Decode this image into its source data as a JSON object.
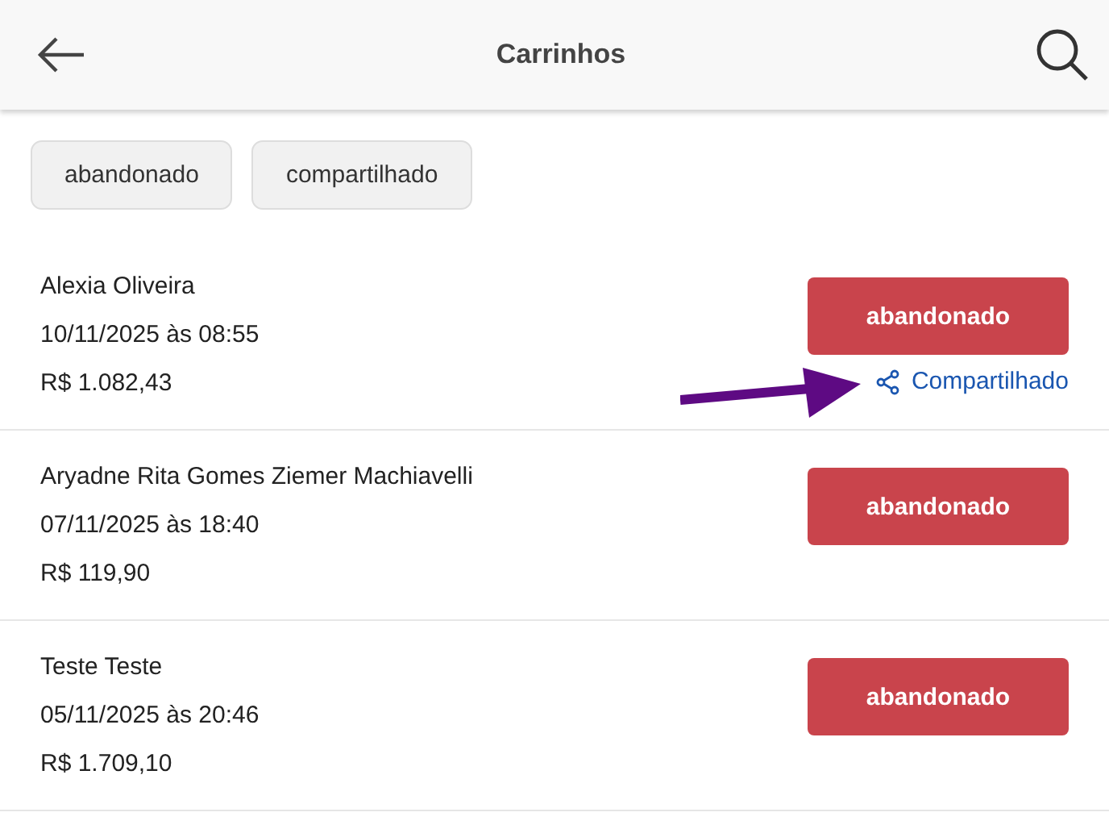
{
  "header": {
    "title": "Carrinhos"
  },
  "filters": [
    {
      "label": "abandonado"
    },
    {
      "label": "compartilhado"
    }
  ],
  "carts": [
    {
      "name": "Alexia Oliveira",
      "date": "10/11/2025 às 08:55",
      "total": "R$ 1.082,43",
      "status": "abandonado",
      "shared": true,
      "shared_label": "Compartilhado",
      "highlighted": true
    },
    {
      "name": "Aryadne Rita Gomes Ziemer Machiavelli",
      "date": "07/11/2025 às 18:40",
      "total": "R$ 119,90",
      "status": "abandonado",
      "shared": false,
      "highlighted": false
    },
    {
      "name": "Teste Teste",
      "date": "05/11/2025 às 20:46",
      "total": "R$ 1.709,10",
      "status": "abandonado",
      "shared": false,
      "highlighted": false
    }
  ]
}
